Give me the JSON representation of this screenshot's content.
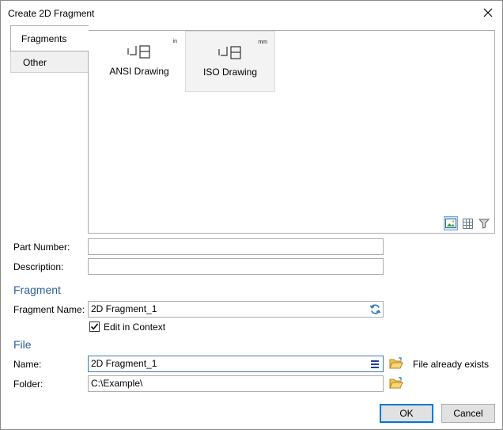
{
  "window": {
    "title": "Create 2D Fragment"
  },
  "tabs": [
    {
      "label": "Fragments"
    },
    {
      "label": "Other"
    }
  ],
  "templates": [
    {
      "label": "ANSI Drawing",
      "unit": "in"
    },
    {
      "label": "ISO Drawing",
      "unit": "mm"
    }
  ],
  "form": {
    "part_number_label": "Part Number:",
    "part_number_value": "",
    "description_label": "Description:",
    "description_value": ""
  },
  "fragment_section": {
    "heading": "Fragment",
    "name_label": "Fragment Name:",
    "name_value": "2D Fragment_1",
    "edit_in_context_label": "Edit in Context",
    "edit_in_context_checked": true
  },
  "file_section": {
    "heading": "File",
    "name_label": "Name:",
    "name_value": "2D Fragment_1",
    "folder_label": "Folder:",
    "folder_value": "C:\\Example\\",
    "status_text": "File already exists"
  },
  "buttons": {
    "ok_label": "OK",
    "cancel_label": "Cancel"
  },
  "icons": {
    "close": "close-icon",
    "drawing": "drawing-template-icon",
    "refresh": "refresh-icon",
    "menu": "menu-icon",
    "folder": "folder-open-icon",
    "view_thumbnails": "thumbnail-view-icon",
    "view_grid": "grid-view-icon",
    "filter": "filter-icon"
  },
  "colors": {
    "section_heading": "#2c5f9e",
    "accent_border": "#0078d7",
    "folder": "#e8b23a"
  }
}
